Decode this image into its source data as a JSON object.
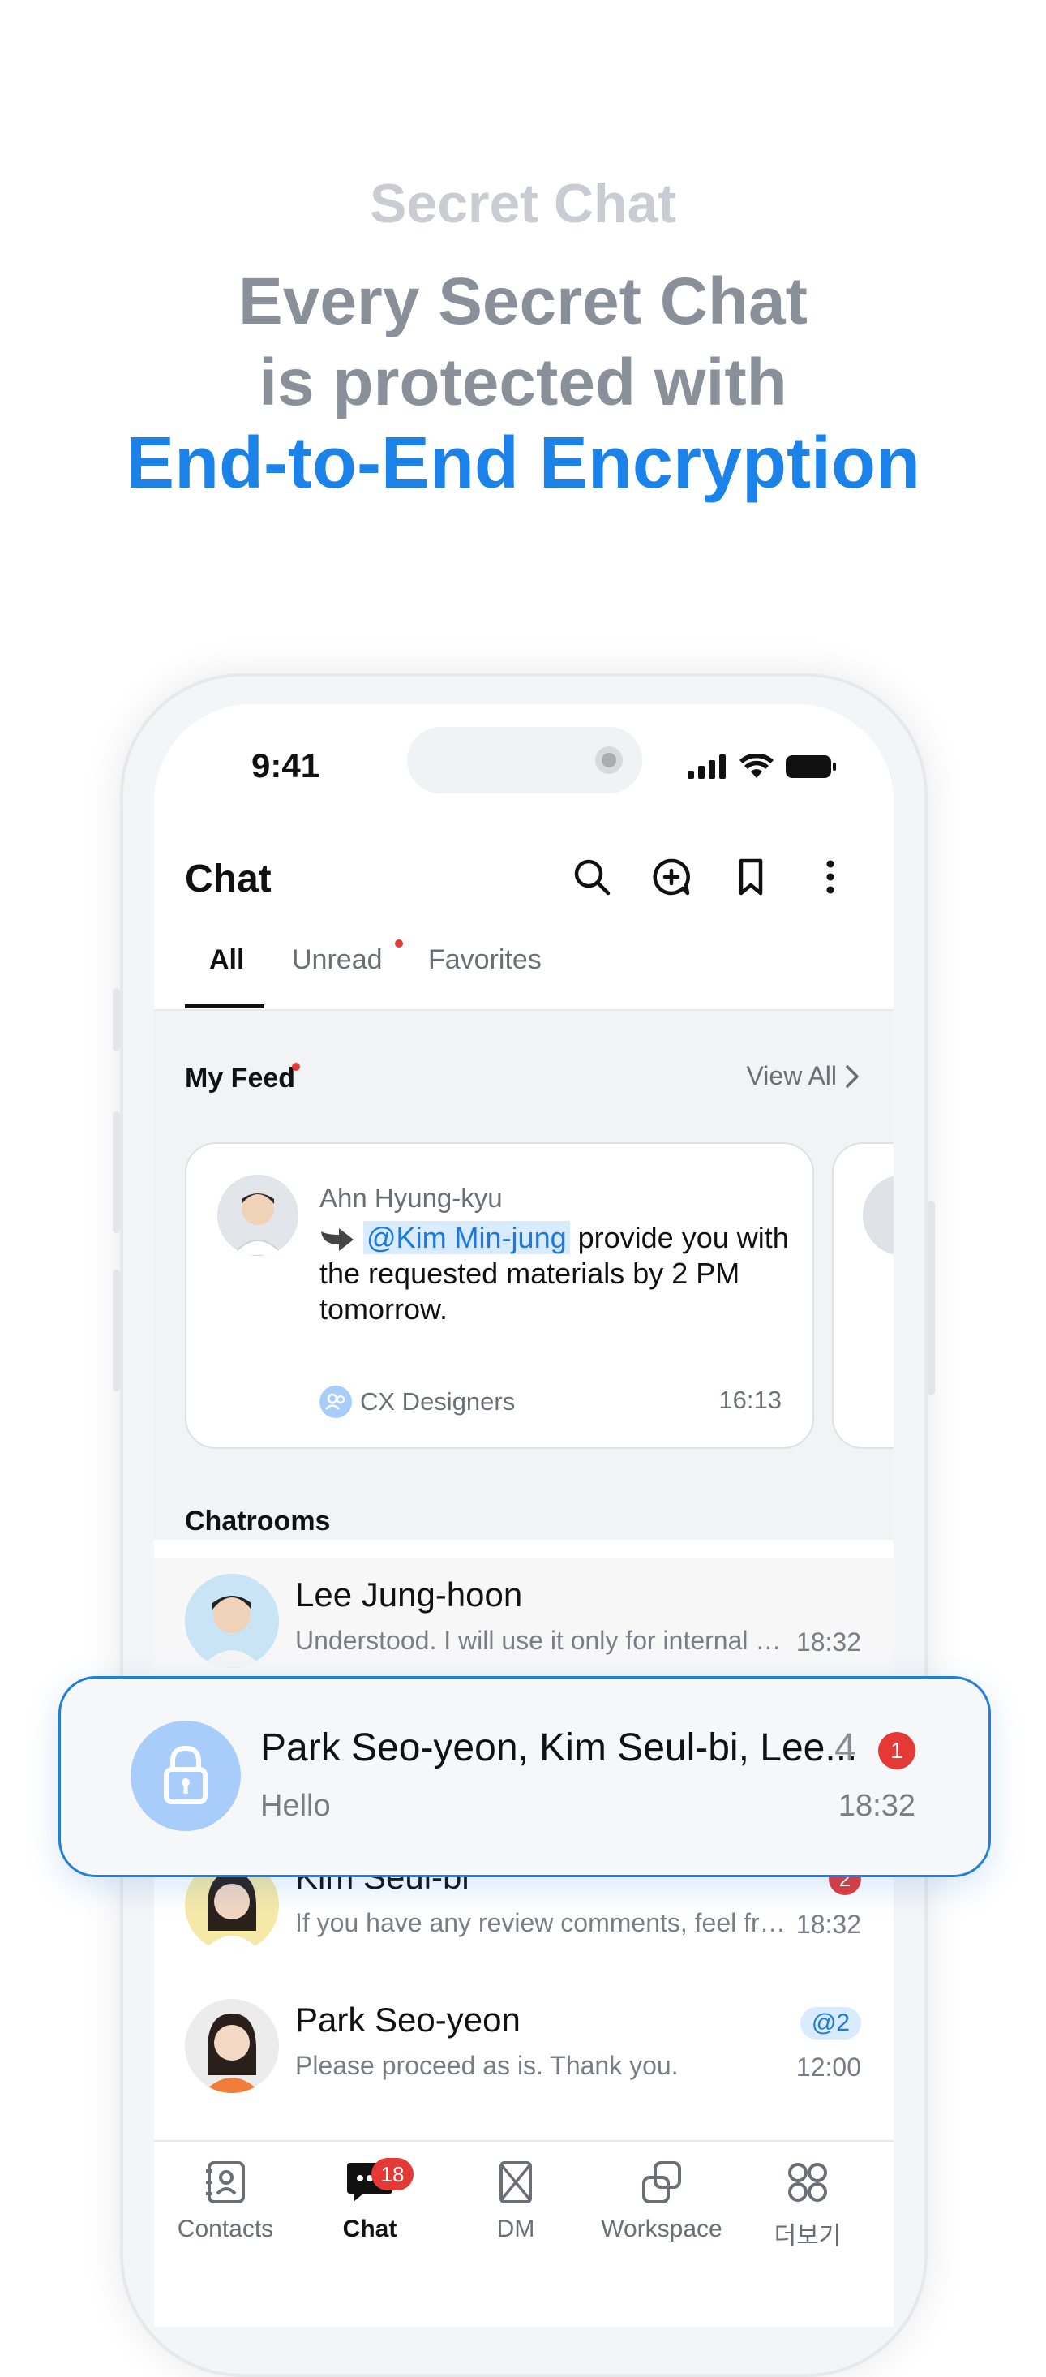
{
  "hero": {
    "kicker": "Secret Chat",
    "line1": "Every Secret Chat",
    "line2": "is protected with",
    "line3": "End-to-End Encryption"
  },
  "status_bar": {
    "time": "9:41"
  },
  "header": {
    "title": "Chat"
  },
  "tabs": [
    "All",
    "Unread",
    "Favorites"
  ],
  "feed": {
    "title": "My Feed",
    "view_all": "View All",
    "card": {
      "sender": "Ahn Hyung-kyu",
      "mention": "@Kim Min-jung",
      "message": " provide you with the requested materials by 2 PM tomorrow.",
      "room": "CX Designers",
      "time": "16:13"
    }
  },
  "chatrooms": {
    "title": "Chatrooms",
    "rows": [
      {
        "name": "Lee Jung-hoon",
        "message": "Understood. I will use it only for internal re...",
        "time": "18:32"
      },
      {
        "name": "Kim Seul-bi",
        "message": "If you have any review comments, feel fre...",
        "time": "18:32",
        "badge": "2"
      },
      {
        "name": "Park Seo-yeon",
        "message": "Please proceed as is. Thank you.",
        "time": "12:00",
        "mention_badge": "@2"
      }
    ]
  },
  "popup": {
    "name": "Park Seo-yeon, Kim Seul-bi, Lee...",
    "count": "4",
    "badge": "1",
    "message": "Hello",
    "time": "18:32"
  },
  "tabbar": {
    "items": [
      {
        "label": "Contacts",
        "icon": "contacts-icon"
      },
      {
        "label": "Chat",
        "icon": "chat-icon",
        "badge": "18"
      },
      {
        "label": "DM",
        "icon": "dm-icon"
      },
      {
        "label": "Workspace",
        "icon": "workspace-icon"
      },
      {
        "label": "더보기",
        "icon": "more-apps-icon"
      }
    ]
  },
  "colors": {
    "accent": "#1a82e8",
    "badge": "#e53935",
    "mention_bg": "#d9ecff"
  }
}
